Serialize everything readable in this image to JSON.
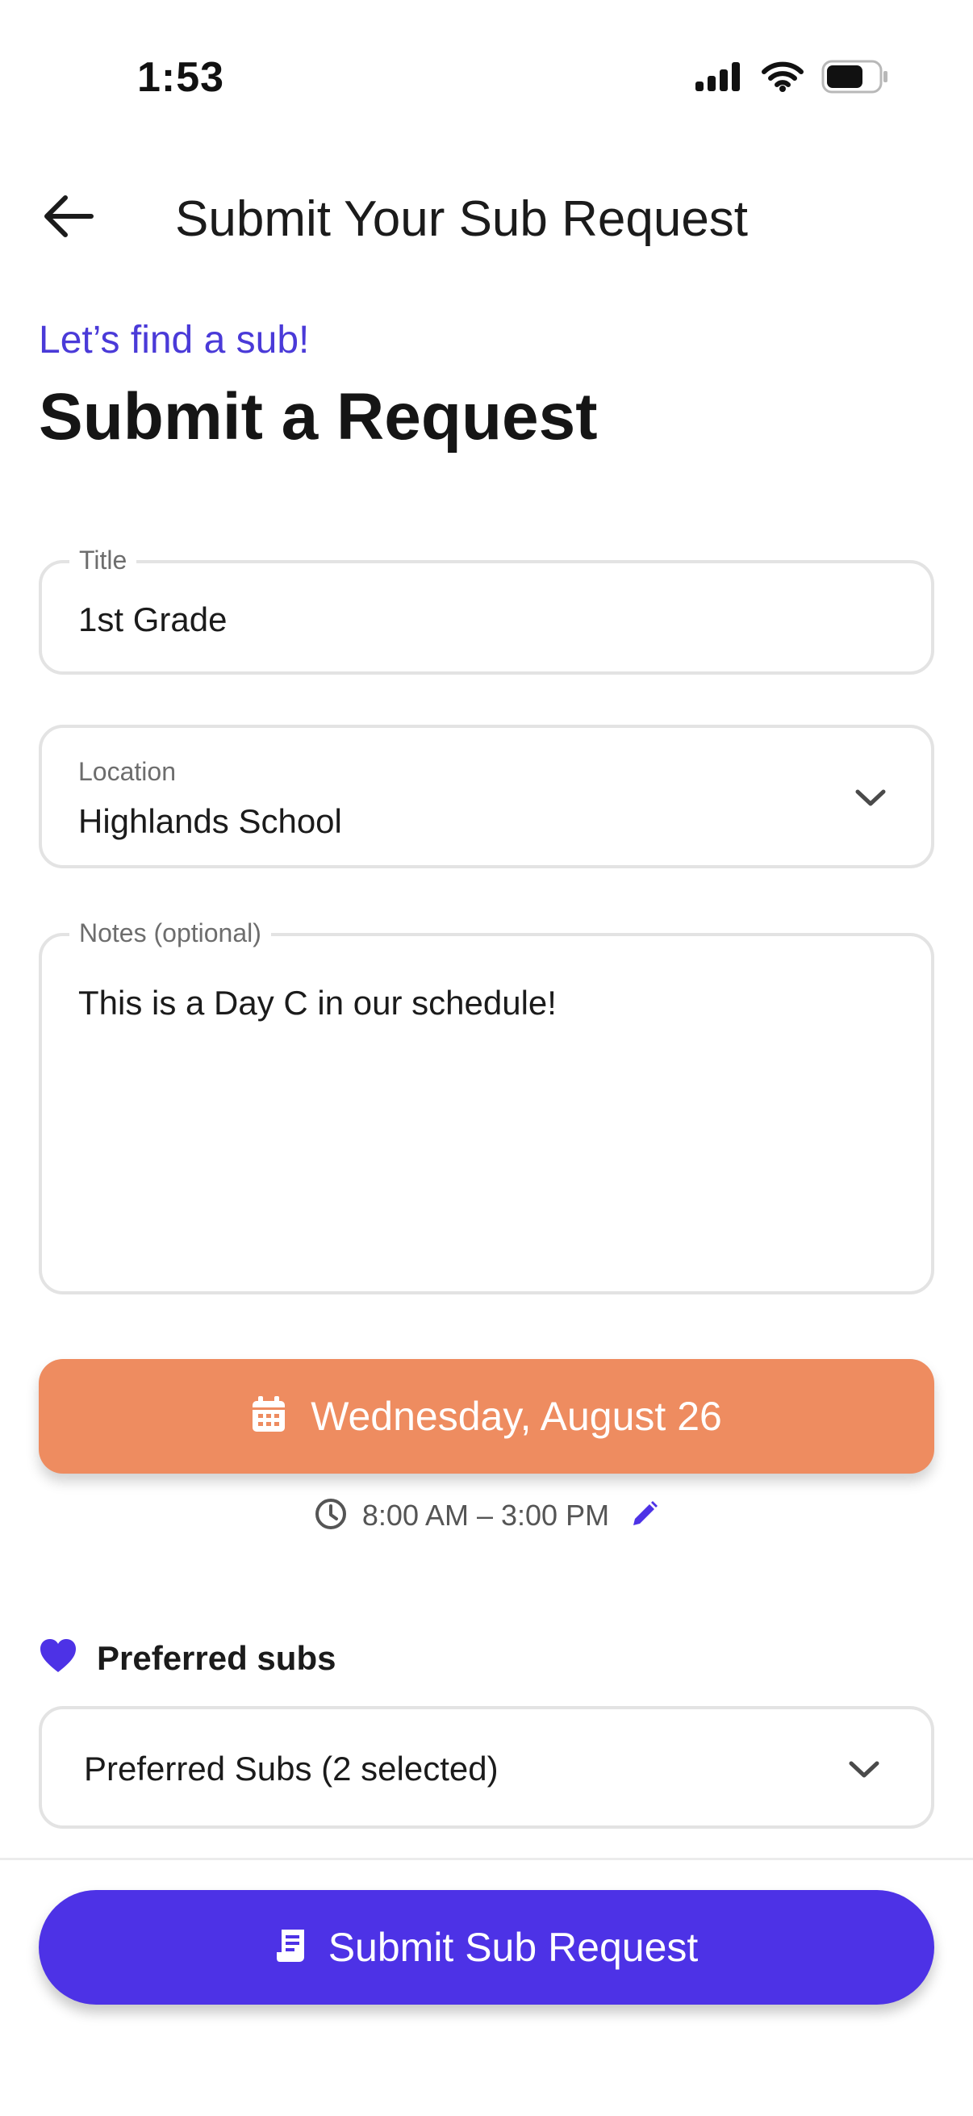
{
  "status_bar": {
    "time": "1:53",
    "icons": [
      "cellular-signal-icon",
      "wifi-icon",
      "battery-icon"
    ]
  },
  "header": {
    "back_icon": "arrow-left-icon",
    "title": "Submit Your Sub Request"
  },
  "intro": {
    "eyebrow": "Let’s find a sub!",
    "title": "Submit a Request"
  },
  "form": {
    "title_field": {
      "label": "Title",
      "value": "1st Grade"
    },
    "location_field": {
      "label": "Location",
      "value": "Highlands School",
      "icon": "chevron-down-icon"
    },
    "notes_field": {
      "label": "Notes (optional)",
      "value": "This is a Day C in our schedule!"
    },
    "date_button": {
      "icon": "calendar-icon",
      "label": "Wednesday, August 26"
    },
    "time_range": {
      "icon": "clock-icon",
      "text": "8:00 AM – 3:00 PM",
      "edit_icon": "pencil-icon"
    },
    "preferred": {
      "icon": "heart-icon",
      "heading": "Preferred subs",
      "value": "Preferred Subs (2 selected)"
    }
  },
  "submit_button": {
    "icon": "receipt-icon",
    "label": "Submit Sub Request"
  },
  "colors": {
    "accent": "#4d32e6",
    "eyebrow": "#4a3ad8",
    "date_button": "#ee8c60",
    "border": "#e3e3e3"
  }
}
